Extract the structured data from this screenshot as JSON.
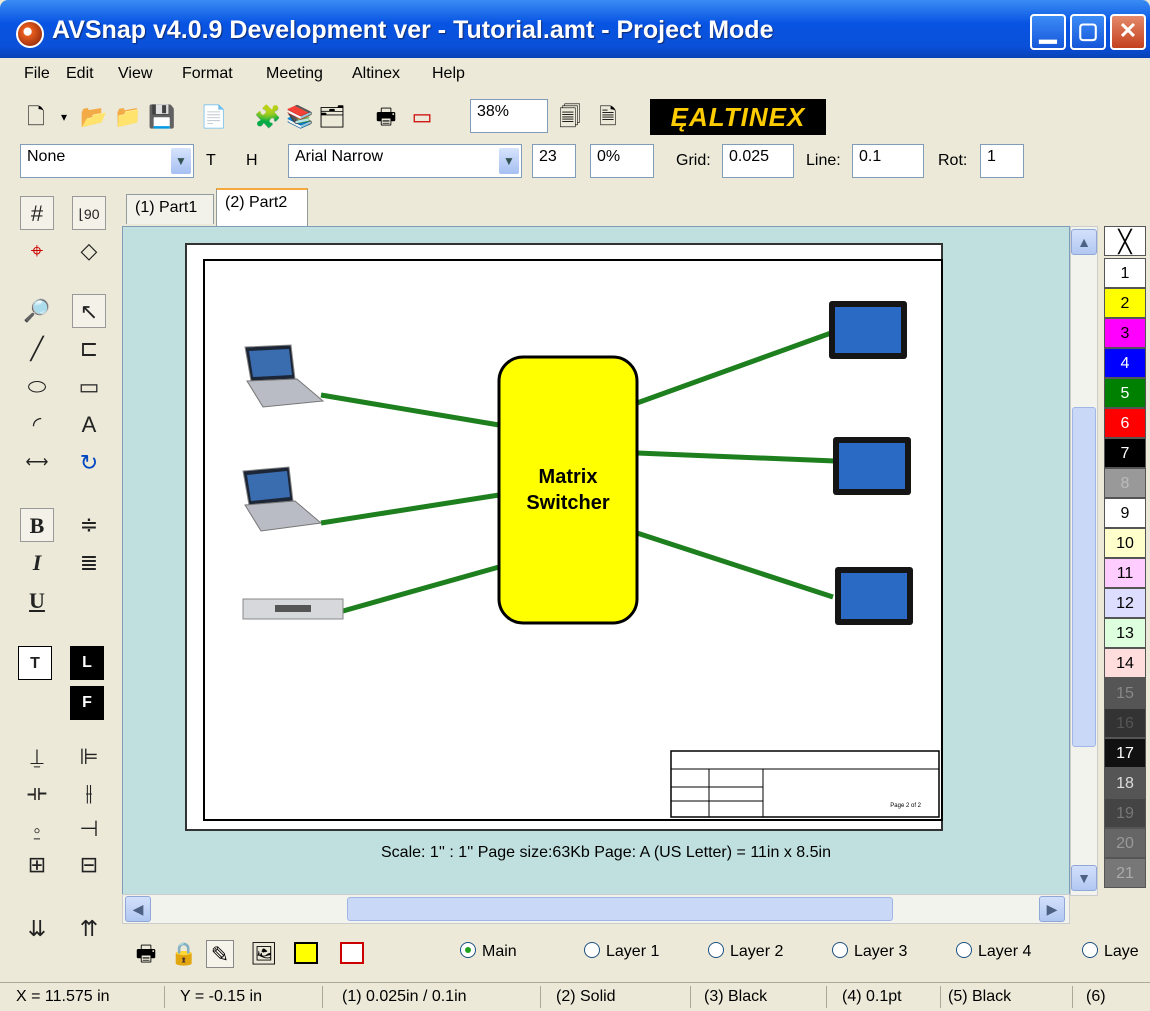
{
  "window": {
    "title": "AVSnap v4.0.9 Development ver - Tutorial.amt - Project Mode"
  },
  "menu": [
    "File",
    "Edit",
    "View",
    "Format",
    "Meeting",
    "Altinex",
    "Help"
  ],
  "toolbar": {
    "zoom": "38%",
    "brand": "ĘALTINEX"
  },
  "format": {
    "style": "None",
    "t_label": "T",
    "h_label": "H",
    "font": "Arial Narrow",
    "size": "23",
    "percent": "0%",
    "grid_label": "Grid:",
    "grid": "0.025",
    "line_label": "Line:",
    "line": "0.1",
    "rot_label": "Rot:",
    "rot": "1"
  },
  "tabs": [
    "(1) Part1",
    "(2) Part2"
  ],
  "diagram": {
    "switcher_line1": "Matrix",
    "switcher_line2": "Switcher",
    "titleblock_page": "Page 2 of 2",
    "connector_color": "#1e7f1e",
    "switcher_color": "#ffff00"
  },
  "scale_text": "Scale: 1'' : 1''   Page size:63Kb   Page: A (US Letter) = 11in x 8.5in",
  "palette": [
    {
      "label": "1",
      "color": "#ffffff",
      "text": "#000"
    },
    {
      "label": "2",
      "color": "#ffff00",
      "text": "#000"
    },
    {
      "label": "3",
      "color": "#ff00ff",
      "text": "#000"
    },
    {
      "label": "4",
      "color": "#0000ff",
      "text": "#fff"
    },
    {
      "label": "5",
      "color": "#008000",
      "text": "#fff"
    },
    {
      "label": "6",
      "color": "#ff0000",
      "text": "#fff"
    },
    {
      "label": "7",
      "color": "#000000",
      "text": "#fff"
    },
    {
      "label": "8",
      "color": "#999999",
      "text": "#bbb"
    },
    {
      "label": "9",
      "color": "#ffffff",
      "text": "#000"
    },
    {
      "label": "10",
      "color": "#ffffcc",
      "text": "#000"
    },
    {
      "label": "11",
      "color": "#ffccff",
      "text": "#000"
    },
    {
      "label": "12",
      "color": "#ddddff",
      "text": "#000"
    },
    {
      "label": "13",
      "color": "#ddffdd",
      "text": "#000"
    },
    {
      "label": "14",
      "color": "#ffdddd",
      "text": "#000"
    },
    {
      "label": "15",
      "color": "#555555",
      "text": "#888"
    },
    {
      "label": "16",
      "color": "#333333",
      "text": "#555"
    },
    {
      "label": "17",
      "color": "#111111",
      "text": "#fff"
    },
    {
      "label": "18",
      "color": "#555555",
      "text": "#ddd"
    },
    {
      "label": "19",
      "color": "#444444",
      "text": "#777"
    },
    {
      "label": "20",
      "color": "#666666",
      "text": "#999"
    },
    {
      "label": "21",
      "color": "#777777",
      "text": "#aaa"
    }
  ],
  "layers": [
    "Main",
    "Layer 1",
    "Layer 2",
    "Layer 3",
    "Layer 4",
    "Laye"
  ],
  "status": {
    "x": "X = 11.575 in",
    "y": "Y = -0.15 in",
    "s1": "(1) 0.025in / 0.1in",
    "s2": "(2) Solid",
    "s3": "(3) Black",
    "s4": "(4) 0.1pt",
    "s5": "(5) Black",
    "s6": "(6)"
  }
}
